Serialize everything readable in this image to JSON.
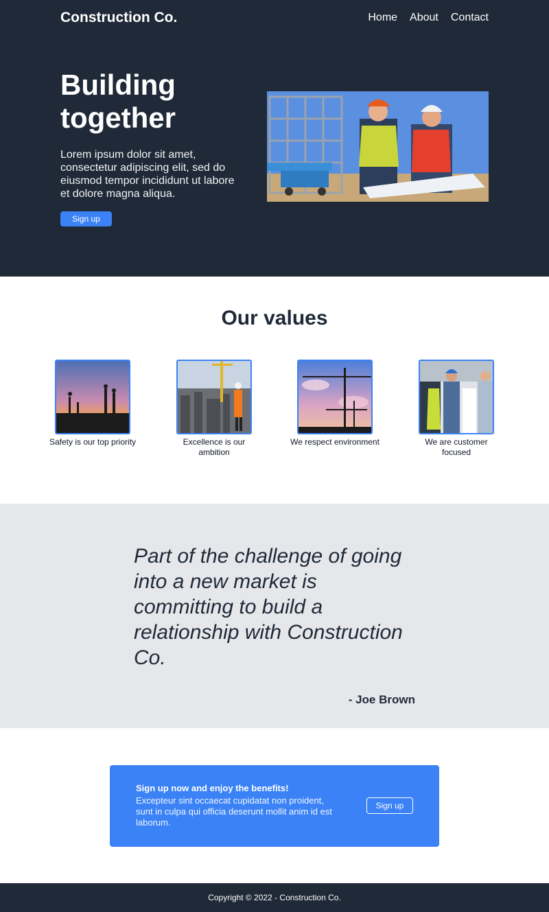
{
  "nav": {
    "logo": "Construction Co.",
    "links": [
      "Home",
      "About",
      "Contact"
    ]
  },
  "hero": {
    "title_line1": "Building",
    "title_line2": "together",
    "body": "Lorem ipsum dolor sit amet, consectetur adipiscing elit, sed do eiusmod tempor incididunt ut labore et dolore magna aliqua.",
    "button": "Sign up"
  },
  "values": {
    "title": "Our values",
    "items": [
      {
        "label": "Safety is our top priority"
      },
      {
        "label": "Excellence is our ambition"
      },
      {
        "label": "We respect environment"
      },
      {
        "label": "We are customer focused"
      }
    ]
  },
  "quote": {
    "text": "Part of the challenge of going into a new market is committing to build a relationship with Construction Co.",
    "author": "- Joe Brown"
  },
  "cta": {
    "title": "Sign up now and enjoy the benefits!",
    "body": "Excepteur sint occaecat cupidatat non proident, sunt in culpa qui officia deserunt mollit anim id est laborum.",
    "button": "Sign up"
  },
  "footer": {
    "text": "Copyright © 2022 - Construction Co."
  },
  "colors": {
    "dark": "#1f2937",
    "accent": "#3b82f6",
    "light_gray": "#e5e7eb"
  }
}
